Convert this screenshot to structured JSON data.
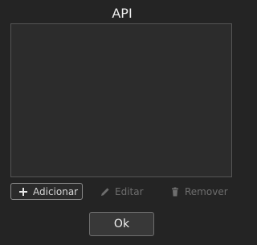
{
  "dialog": {
    "title": "API"
  },
  "toolbar": {
    "add_label": "Adicionar",
    "edit_label": "Editar",
    "remove_label": "Remover",
    "add_icon": "plus-icon",
    "edit_icon": "pencil-icon",
    "remove_icon": "trash-icon"
  },
  "footer": {
    "ok_label": "Ok"
  },
  "colors": {
    "background": "#242424",
    "panel": "#2c2c2c",
    "disabled_text": "#6e6e6e"
  }
}
